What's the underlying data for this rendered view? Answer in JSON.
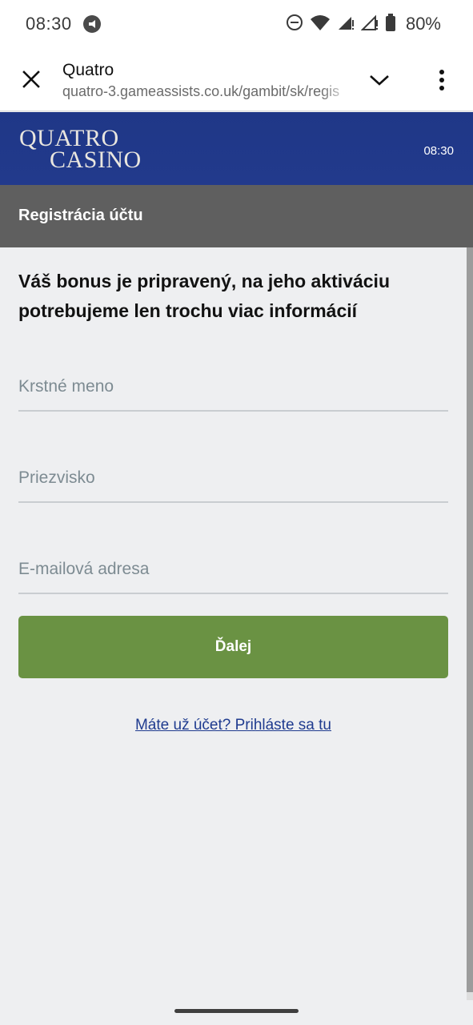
{
  "status_bar": {
    "time": "08:30",
    "battery": "80%",
    "icons": [
      "media-notification-icon",
      "do-not-disturb-icon",
      "wifi-icon",
      "signal-icon",
      "signal-icon",
      "battery-icon"
    ]
  },
  "browser": {
    "title": "Quatro",
    "url": "quatro-3.gameassists.co.uk/gambit/sk/regis",
    "icons": [
      "close-icon",
      "chevron-down-icon",
      "more-vert-icon"
    ]
  },
  "site_header": {
    "logo_line1": "QUATRO",
    "logo_line2": "CASINO",
    "time": "08:30",
    "color": "#223a8c"
  },
  "page": {
    "title": "Registrácia účtu",
    "intro": "Váš bonus je pripravený, na jeho aktiváciu potrebujeme len trochu viac informácií",
    "fields": {
      "first_name": {
        "placeholder": "Krstné meno",
        "value": ""
      },
      "last_name": {
        "placeholder": "Priezvisko",
        "value": ""
      },
      "email": {
        "placeholder": "E-mailová adresa",
        "value": ""
      }
    },
    "submit_label": "Ďalej",
    "submit_color": "#6a9243",
    "login_link": "Máte už účet? Prihláste sa tu"
  }
}
